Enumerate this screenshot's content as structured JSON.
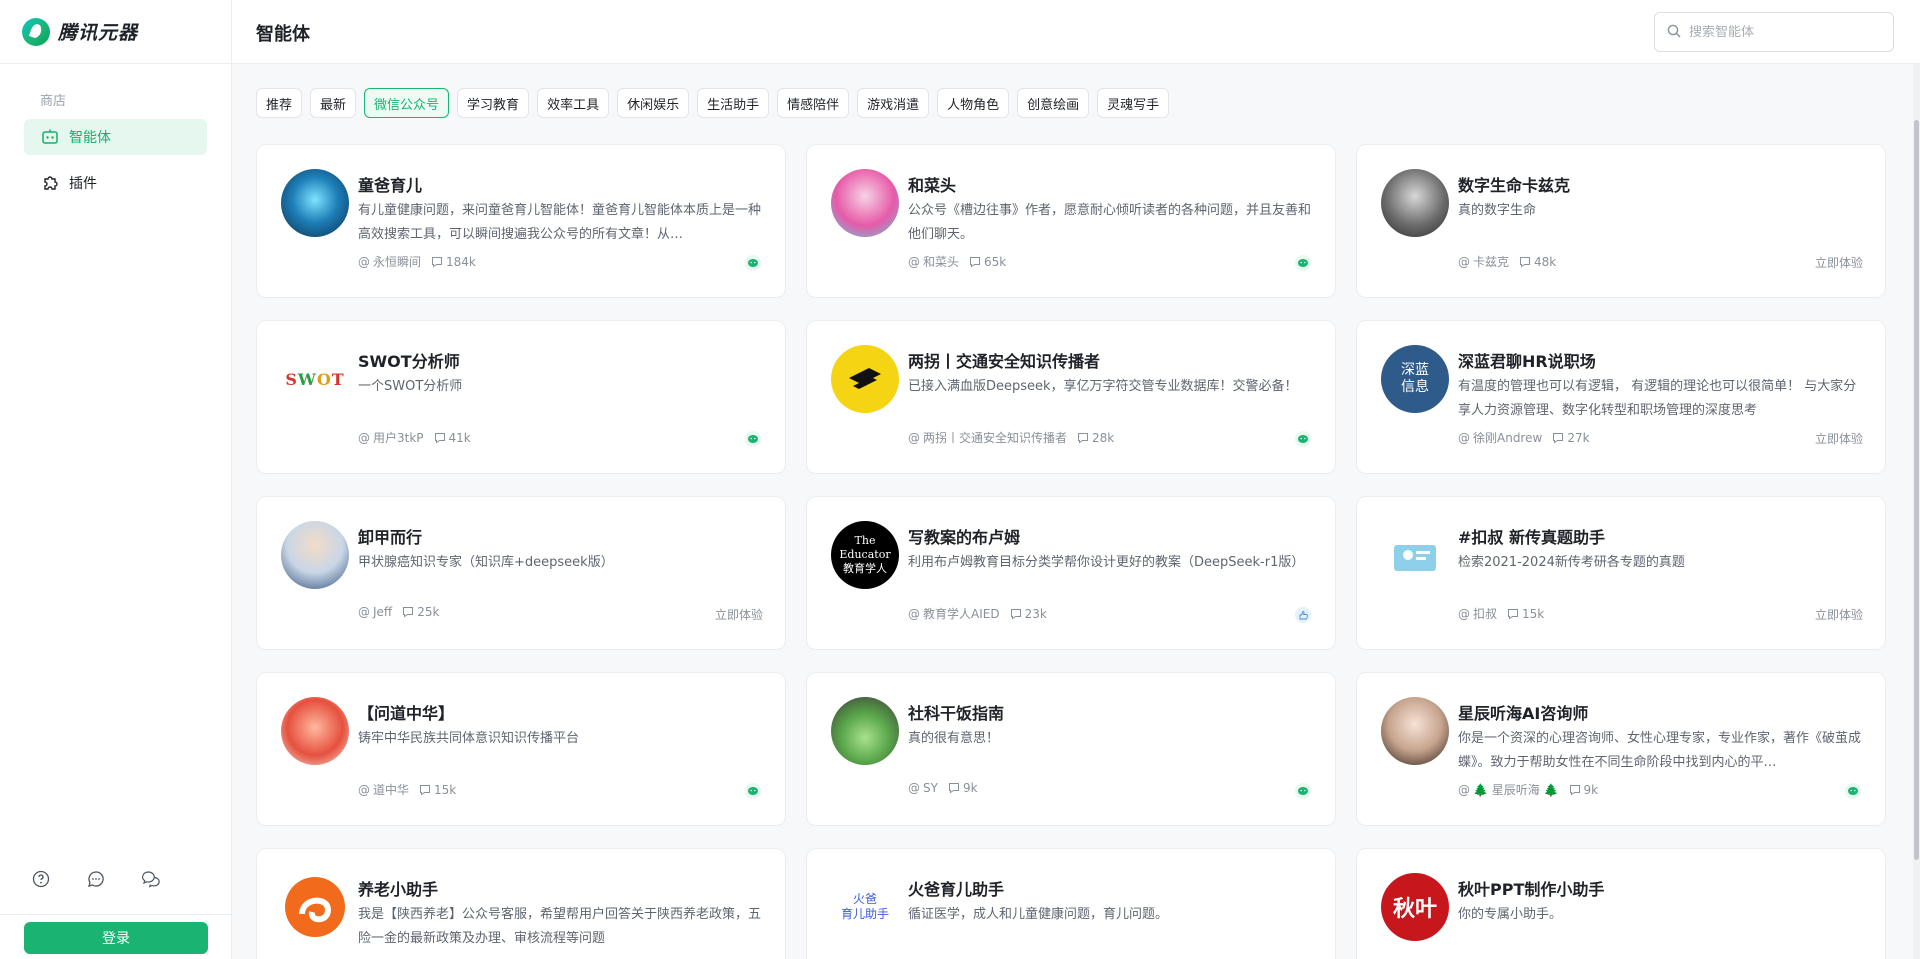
{
  "app": {
    "name": "腾讯元器"
  },
  "sidebar": {
    "section_label": "商店",
    "items": [
      {
        "label": "智能体",
        "icon": "robot-icon",
        "active": true
      },
      {
        "label": "插件",
        "icon": "puzzle-icon",
        "active": false
      }
    ],
    "bottom_icons": [
      "help-icon",
      "chat-icon",
      "wechat-icon"
    ],
    "login_label": "登录"
  },
  "header": {
    "title": "智能体",
    "search_placeholder": "搜索智能体"
  },
  "tabs": [
    {
      "label": "推荐",
      "active": false
    },
    {
      "label": "最新",
      "active": false
    },
    {
      "label": "微信公众号",
      "active": true
    },
    {
      "label": "学习教育",
      "active": false
    },
    {
      "label": "效率工具",
      "active": false
    },
    {
      "label": "休闲娱乐",
      "active": false
    },
    {
      "label": "生活助手",
      "active": false
    },
    {
      "label": "情感陪伴",
      "active": false
    },
    {
      "label": "游戏消遣",
      "active": false
    },
    {
      "label": "人物角色",
      "active": false
    },
    {
      "label": "创意绘画",
      "active": false
    },
    {
      "label": "灵魂写手",
      "active": false
    }
  ],
  "try_label": "立即体验",
  "colors": {
    "accent": "#1ab371",
    "tab_active_bg": "#eefaf4",
    "nav_active_bg": "#e6f7ef"
  },
  "cards": [
    {
      "title": "童爸育儿",
      "desc": "有儿童健康问题，来问童爸育儿智能体！童爸育儿智能体本质上是一种高效搜索工具，可以瞬间搜遍我公众号的所有文章！从…",
      "author": "永恒瞬间",
      "count": "184k",
      "end": "wechat",
      "avatar": "robot-avatar"
    },
    {
      "title": "和菜头",
      "desc": "公众号《槽边往事》作者，愿意耐心倾听读者的各种问题，并且友善和他们聊天。",
      "author": "和菜头",
      "count": "65k",
      "end": "wechat",
      "avatar": "anime-avatar"
    },
    {
      "title": "数字生命卡兹克",
      "desc": "真的数字生命",
      "author": "卡兹克",
      "count": "48k",
      "end": "try",
      "avatar": "cyber-avatar"
    },
    {
      "title": "SWOT分析师",
      "desc": "一个SWOT分析师",
      "author": "用户3tkP",
      "count": "41k",
      "end": "wechat",
      "avatar": "swot-avatar",
      "avatar_text": "SWOT"
    },
    {
      "title": "两拐丨交通安全知识传播者",
      "desc": "已接入满血版Deepseek，享亿万字符交管专业数据库！交警必备！",
      "author": "两拐丨交通安全知识传播者",
      "count": "28k",
      "end": "wechat",
      "avatar": "yellow-arrow-avatar"
    },
    {
      "title": "深蓝君聊HR说职场",
      "desc": "有温度的管理也可以有逻辑， 有逻辑的理论也可以很简单！ 与大家分享人力资源管理、数字化转型和职场管理的深度思考",
      "author": "徐刚Andrew",
      "count": "27k",
      "end": "try",
      "avatar": "deepblue-avatar",
      "avatar_text": "深蓝\n信息"
    },
    {
      "title": "卸甲而行",
      "desc": "甲状腺癌知识专家（知识库+deepseek版）",
      "author": "Jeff",
      "count": "25k",
      "end": "try",
      "avatar": "doctor-avatar"
    },
    {
      "title": "写教案的布卢姆",
      "desc": "利用布卢姆教育目标分类学帮你设计更好的教案（DeepSeek-r1版）",
      "author": "教育学人AIED",
      "count": "23k",
      "end": "thumb",
      "avatar": "educator-avatar",
      "avatar_text": "The\nEducator\n教育学人"
    },
    {
      "title": "#扣叔 新传真题助手",
      "desc": "检索2021-2024新传考研各专题的真题",
      "author": "扣叔",
      "count": "15k",
      "end": "try",
      "avatar": "study-avatar"
    },
    {
      "title": "【问道中华】",
      "desc": "铸牢中华民族共同体意识知识传播平台",
      "author": "道中华",
      "count": "15k",
      "end": "wechat",
      "avatar": "mascot-avatar"
    },
    {
      "title": "社科干饭指南",
      "desc": "真的很有意思！",
      "author": "SY",
      "count": "9k",
      "end": "wechat",
      "avatar": "duck-avatar"
    },
    {
      "title": "星辰听海AI咨询师",
      "desc": "你是一个资深的心理咨询师、女性心理专家，专业作家，著作《破茧成蝶》。致力于帮助女性在不同生命阶段中找到内心的平…",
      "author": "🌲 星辰听海 🌲",
      "count": "9k",
      "end": "wechat",
      "avatar": "woman-avatar"
    },
    {
      "title": "养老小助手",
      "desc": "我是【陕西养老】公众号客服，希望帮用户回答关于陕西养老政策，五险一金的最新政策及办理、审核流程等问题",
      "author": "",
      "count": "",
      "end": "",
      "avatar": "orange-logo-avatar"
    },
    {
      "title": "火爸育儿助手",
      "desc": "循证医学，成人和儿童健康问题，育儿问题。",
      "author": "",
      "count": "",
      "end": "",
      "avatar": "fire-avatar",
      "avatar_text": "火爸\n育儿助手"
    },
    {
      "title": "秋叶PPT制作小助手",
      "desc": "你的专属小助手。",
      "author": "",
      "count": "",
      "end": "",
      "avatar": "qiuye-avatar",
      "avatar_text": "秋叶"
    }
  ]
}
